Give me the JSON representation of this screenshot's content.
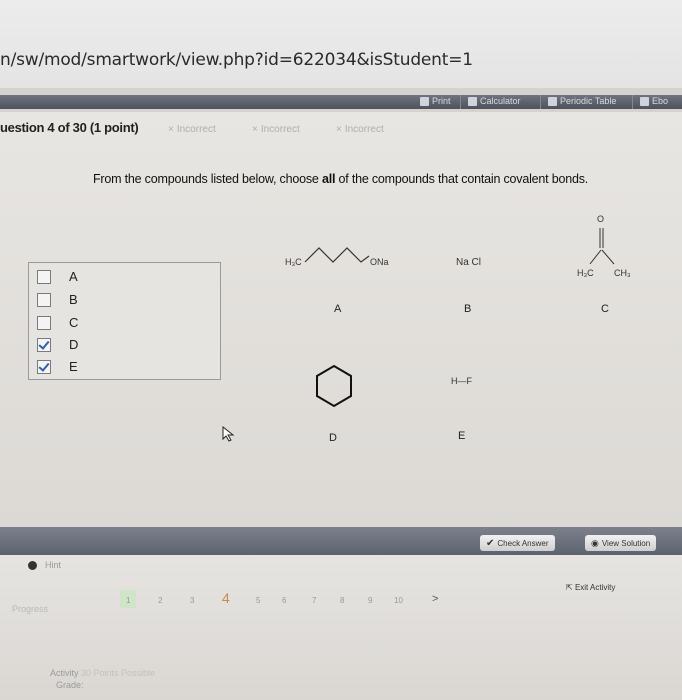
{
  "url": "n/sw/mod/smartwork/view.php?id=622034&isStudent=1",
  "toolbar": {
    "print": "Print",
    "calculator": "Calculator",
    "periodic_table": "Periodic Table",
    "ebook": "Ebo"
  },
  "question": {
    "info": "uestion 4 of 30 (1 point)",
    "attempts": [
      "Incorrect",
      "Incorrect",
      "Incorrect"
    ],
    "prompt_pre": "From the compounds listed below, choose ",
    "prompt_bold": "all",
    "prompt_post": " of the compounds that contain covalent bonds."
  },
  "choices": [
    {
      "label": "A",
      "checked": false
    },
    {
      "label": "B",
      "checked": false
    },
    {
      "label": "C",
      "checked": false
    },
    {
      "label": "D",
      "checked": true
    },
    {
      "label": "E",
      "checked": true
    }
  ],
  "compounds": {
    "A": {
      "label": "A",
      "left": "H₃C",
      "right": "ONa"
    },
    "B": {
      "label": "B",
      "formula": "Na Cl"
    },
    "C": {
      "label": "C",
      "top": "O",
      "left": "H₃C",
      "right": "CH₃"
    },
    "D": {
      "label": "D"
    },
    "E": {
      "label": "E",
      "formula": "H—F"
    }
  },
  "buttons": {
    "check_answer": "Check Answer",
    "view_solution": "View Solution",
    "hint": "Hint",
    "exit_activity": "Exit Activity"
  },
  "progress": {
    "label": "Progress",
    "pages": [
      "1",
      "2",
      "3",
      "4",
      "5",
      "6",
      "7",
      "8",
      "9",
      "10"
    ],
    "current": "4",
    "next": ">"
  },
  "footer": {
    "activity": "Activity",
    "points": "30 Points Possible",
    "grade": "Grade:"
  },
  "colors": {
    "toolbar": "#5a5f6a",
    "checkbox_check": "#2e5fa8",
    "current_page": "#c78a4a"
  }
}
